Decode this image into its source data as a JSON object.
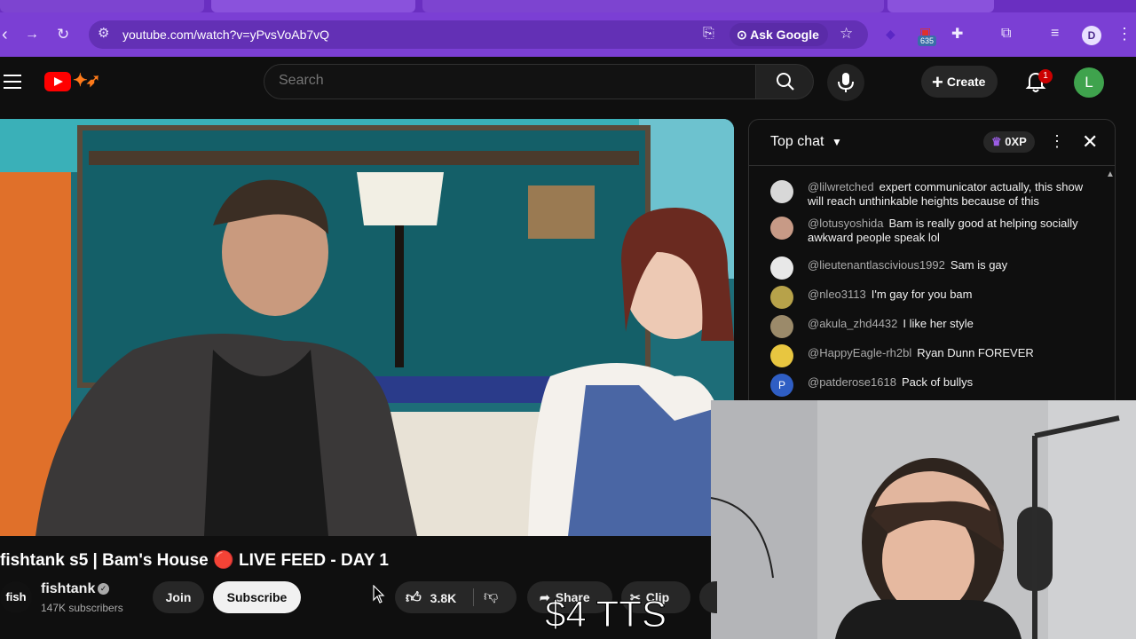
{
  "browser": {
    "url": "youtube.com/watch?v=yPvsVoAb7vQ",
    "ask_google": "Ask Google",
    "extension_badge": "635",
    "profile_initial": "D"
  },
  "youtube": {
    "search_placeholder": "Search",
    "create_label": "Create",
    "notification_count": "1",
    "avatar_initial": "L"
  },
  "chat": {
    "title": "Top chat",
    "xp": "0XP",
    "messages": [
      {
        "author": "@lilwretched",
        "text": "expert communicator actually, this show will reach unthinkable heights because of this",
        "color": "#d8d8d8"
      },
      {
        "author": "@lotusyoshida",
        "text": "Bam is really good at helping socially awkward people speak lol",
        "color": "#c79a86"
      },
      {
        "author": "@lieutenantlascivious1992",
        "text": "Sam is gay",
        "color": "#e8e8e8"
      },
      {
        "author": "@nleo3113",
        "text": "I'm gay for you bam",
        "color": "#b7a24a"
      },
      {
        "author": "@akula_zhd4432",
        "text": "I like her style",
        "color": "#9b8a6a"
      },
      {
        "author": "@HappyEagle-rh2bl",
        "text": "Ryan Dunn FOREVER",
        "color": "#e8c640"
      },
      {
        "author": "@patderose1618",
        "text": "Pack of bullys",
        "color": "#2f5ec4",
        "initial": "P"
      }
    ]
  },
  "video": {
    "title": "fishtank s5 | Bam's House 🔴 LIVE FEED - DAY 1",
    "channel": "fishtank",
    "channel_avatar_text": "fish",
    "subscribers": "147K subscribers",
    "join_label": "Join",
    "subscribe_label": "Subscribe",
    "likes": "3.8K",
    "share_label": "Share",
    "clip_label": "Clip"
  },
  "overlay": {
    "tts_text": "$4 TTS"
  }
}
